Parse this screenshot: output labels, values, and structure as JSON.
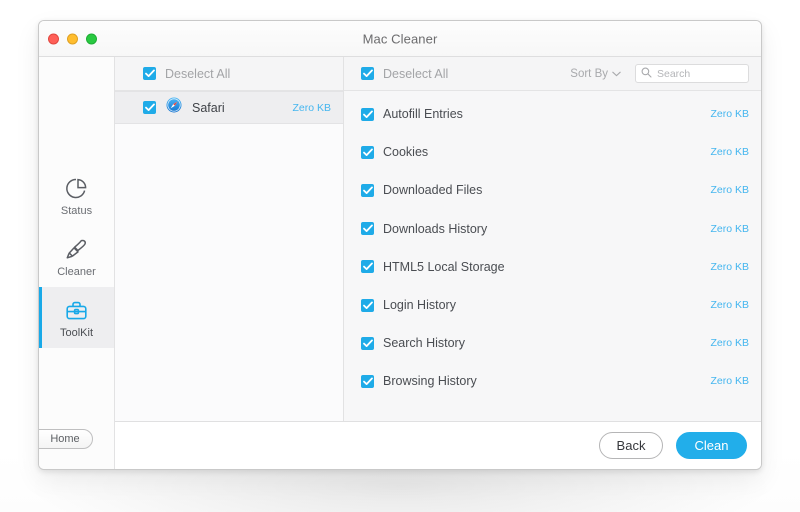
{
  "window": {
    "title": "Mac Cleaner",
    "traffic_lights": [
      {
        "name": "close",
        "color": "#ff5f57"
      },
      {
        "name": "minimize",
        "color": "#ffbd2e"
      },
      {
        "name": "maximize",
        "color": "#29c941"
      }
    ]
  },
  "sidebar": {
    "items": [
      {
        "label": "Status",
        "icon": "pie-chart-icon",
        "active": false
      },
      {
        "label": "Cleaner",
        "icon": "brush-icon",
        "active": false
      },
      {
        "label": "ToolKit",
        "icon": "toolbox-icon",
        "active": true
      }
    ],
    "home_label": "Home"
  },
  "apps_panel": {
    "header": {
      "deselect_all_label": "Deselect All",
      "checked": true
    },
    "rows": [
      {
        "name": "Safari",
        "icon": "safari-compass-icon",
        "size": "Zero KB",
        "checked": true,
        "selected": true
      }
    ]
  },
  "details_panel": {
    "header": {
      "deselect_all_label": "Deselect All",
      "checked": true,
      "sort_by_label": "Sort By",
      "search": {
        "placeholder": "Search",
        "value": ""
      }
    },
    "items": [
      {
        "label": "Autofill Entries",
        "size": "Zero KB",
        "checked": true
      },
      {
        "label": "Cookies",
        "size": "Zero KB",
        "checked": true
      },
      {
        "label": "Downloaded Files",
        "size": "Zero KB",
        "checked": true
      },
      {
        "label": "Downloads History",
        "size": "Zero KB",
        "checked": true
      },
      {
        "label": "HTML5 Local Storage",
        "size": "Zero KB",
        "checked": true
      },
      {
        "label": "Login History",
        "size": "Zero KB",
        "checked": true
      },
      {
        "label": "Search History",
        "size": "Zero KB",
        "checked": true
      },
      {
        "label": "Browsing History",
        "size": "Zero KB",
        "checked": true
      }
    ]
  },
  "footer": {
    "back_label": "Back",
    "clean_label": "Clean"
  },
  "colors": {
    "accent": "#22aeea",
    "checkbox": "#1fabe8",
    "size_text": "#45b6ef",
    "active_nav": "#18a9e8"
  }
}
